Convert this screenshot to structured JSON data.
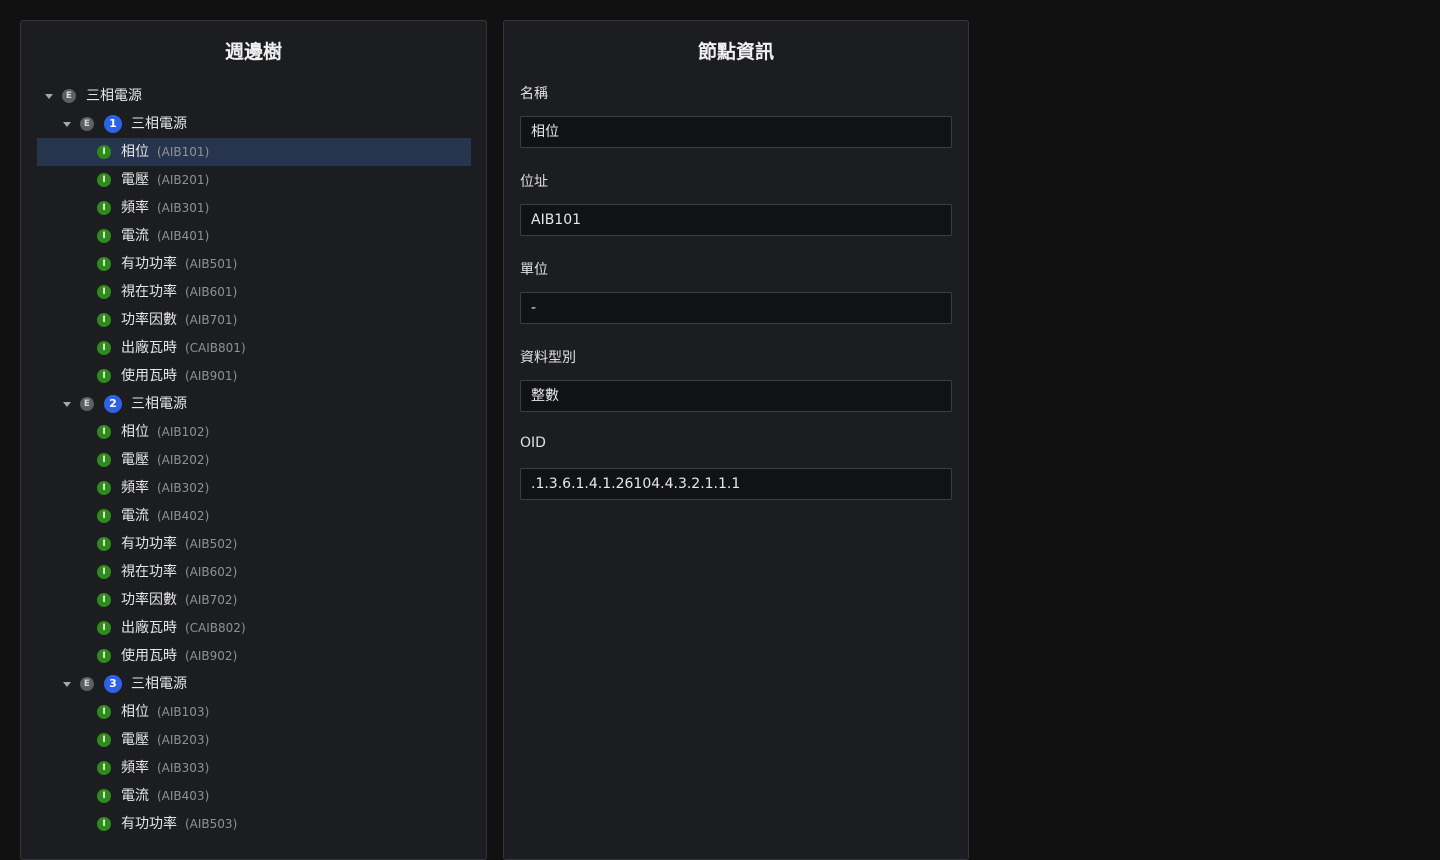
{
  "tree_panel": {
    "title": "週邊樹",
    "root": {
      "label": "三相電源"
    },
    "groups": [
      {
        "number": "1",
        "label": "三相電源",
        "items": [
          {
            "label": "相位",
            "address": "(AIB101)"
          },
          {
            "label": "電壓",
            "address": "(AIB201)"
          },
          {
            "label": "頻率",
            "address": "(AIB301)"
          },
          {
            "label": "電流",
            "address": "(AIB401)"
          },
          {
            "label": "有功功率",
            "address": "(AIB501)"
          },
          {
            "label": "視在功率",
            "address": "(AIB601)"
          },
          {
            "label": "功率因數",
            "address": "(AIB701)"
          },
          {
            "label": "出廠瓦時",
            "address": "(CAIB801)"
          },
          {
            "label": "使用瓦時",
            "address": "(AIB901)"
          }
        ]
      },
      {
        "number": "2",
        "label": "三相電源",
        "items": [
          {
            "label": "相位",
            "address": "(AIB102)"
          },
          {
            "label": "電壓",
            "address": "(AIB202)"
          },
          {
            "label": "頻率",
            "address": "(AIB302)"
          },
          {
            "label": "電流",
            "address": "(AIB402)"
          },
          {
            "label": "有功功率",
            "address": "(AIB502)"
          },
          {
            "label": "視在功率",
            "address": "(AIB602)"
          },
          {
            "label": "功率因數",
            "address": "(AIB702)"
          },
          {
            "label": "出廠瓦時",
            "address": "(CAIB802)"
          },
          {
            "label": "使用瓦時",
            "address": "(AIB902)"
          }
        ]
      },
      {
        "number": "3",
        "label": "三相電源",
        "items": [
          {
            "label": "相位",
            "address": "(AIB103)"
          },
          {
            "label": "電壓",
            "address": "(AIB203)"
          },
          {
            "label": "頻率",
            "address": "(AIB303)"
          },
          {
            "label": "電流",
            "address": "(AIB403)"
          },
          {
            "label": "有功功率",
            "address": "(AIB503)"
          }
        ]
      }
    ],
    "badge_letters": {
      "entity": "E",
      "item": "I"
    },
    "selected": "相位 (AIB101)"
  },
  "info_panel": {
    "title": "節點資訊",
    "fields": [
      {
        "label": "名稱",
        "value": "相位"
      },
      {
        "label": "位址",
        "value": "AIB101"
      },
      {
        "label": "單位",
        "value": "-"
      },
      {
        "label": "資料型別",
        "value": "整數"
      },
      {
        "label": "OID",
        "value": ".1.3.6.1.4.1.26104.4.3.2.1.1.1"
      }
    ]
  },
  "colors": {
    "background": "#111112",
    "panel": "#1c1d20",
    "selected_row": "#26344d",
    "entity_badge": "#5c5e63",
    "item_badge": "#2f8a1c",
    "number_badge": "#2a63e6"
  }
}
